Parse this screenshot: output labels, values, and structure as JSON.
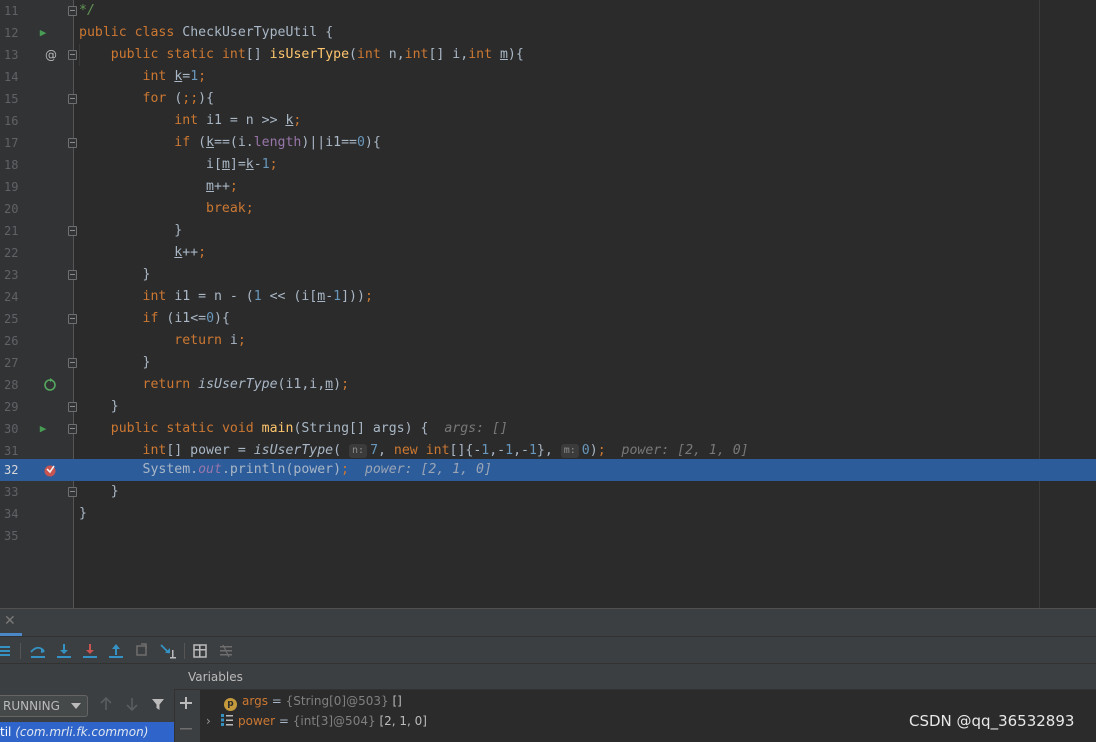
{
  "editor": {
    "lines": [
      {
        "num": "11"
      },
      {
        "num": "12"
      },
      {
        "num": "13"
      },
      {
        "num": "14"
      },
      {
        "num": "15"
      },
      {
        "num": "16"
      },
      {
        "num": "17"
      },
      {
        "num": "18"
      },
      {
        "num": "19"
      },
      {
        "num": "20"
      },
      {
        "num": "21"
      },
      {
        "num": "22"
      },
      {
        "num": "23"
      },
      {
        "num": "24"
      },
      {
        "num": "25"
      },
      {
        "num": "26"
      },
      {
        "num": "27"
      },
      {
        "num": "28"
      },
      {
        "num": "29"
      },
      {
        "num": "30"
      },
      {
        "num": "31"
      },
      {
        "num": "32"
      },
      {
        "num": "33"
      },
      {
        "num": "34"
      },
      {
        "num": "35"
      }
    ],
    "current_line": "32",
    "code": {
      "l11": {
        "cmt": "*/"
      },
      "l12": {
        "kw1": "public",
        "kw2": "class",
        "name": "CheckUserTypeUtil",
        "brace": "{"
      },
      "l13": {
        "kw1": "public",
        "kw2": "static",
        "kw3": "int",
        "arr": "[]",
        "fn": "isUserType",
        "p1": "(",
        "kw4": "int",
        "p2": "n,",
        "kw5": "int",
        "p3": "[] i,",
        "kw6": "int",
        "p4": "m",
        "p5": "){"
      },
      "l14": {
        "kw": "int",
        "v": "k",
        "op": "=",
        "num": "1",
        "semi": ";"
      },
      "l15": {
        "kw": "for",
        "rest1": "(",
        "semi": ";;",
        "rest2": "){"
      },
      "l16": {
        "kw": "int",
        "a": "i1 = n >> ",
        "v": "k",
        "semi": ";"
      },
      "l17": {
        "kw": "if",
        "a": "(",
        "v": "k",
        "b": "==(i.",
        "fld": "length",
        "c": ")||i1==",
        "num": "0",
        "d": "){"
      },
      "l18": {
        "a": "i[",
        "v": "m",
        "b": "]=",
        "v2": "k",
        "c": "-",
        "num": "1",
        "semi": ";"
      },
      "l19": {
        "v": "m",
        "a": "++",
        "semi": ";"
      },
      "l20": {
        "kw": "break",
        "semi": ";"
      },
      "l21": {
        "a": "}"
      },
      "l22": {
        "v": "k",
        "a": "++",
        "semi": ";"
      },
      "l23": {
        "a": "}"
      },
      "l24": {
        "kw": "int",
        "a": "i1 = n - (",
        "num": "1",
        "b": " << (i[",
        "v": "m",
        "c": "-",
        "num2": "1",
        "d": "]))",
        "semi": ";"
      },
      "l25": {
        "kw": "if",
        "a": "(i1<=",
        "num": "0",
        "b": "){"
      },
      "l26": {
        "kw": "return",
        "a": "i",
        "semi": ";"
      },
      "l27": {
        "a": "}"
      },
      "l28": {
        "kw": "return",
        "fn": "isUserType",
        "a": "(i1,i,",
        "v": "m",
        "b": ")",
        "semi": ";"
      },
      "l29": {
        "a": "}"
      },
      "l30": {
        "kw1": "public",
        "kw2": "static",
        "kw3": "void",
        "fn": "main",
        "a": "(String[] args) {",
        "inlay": "args: []"
      },
      "l31": {
        "kw": "int",
        "a": "[] power = ",
        "fn": "isUserType",
        "b": "(",
        "hint1": "n:",
        "num1": "7",
        "c": ", ",
        "kw2": "new",
        "kw3": "int",
        "d": "[]{-",
        "num2": "1",
        "e": ",-",
        "num3": "1",
        "f": ",-",
        "num4": "1",
        "g": "}, ",
        "hint2": "m:",
        "num5": "0",
        "h": ")",
        "semi": ";",
        "inlay": "power: [2, 1, 0]"
      },
      "l32": {
        "a": "System.",
        "fld": "out",
        "b": ".println(power)",
        "semi": ";",
        "inlay": "power: [2, 1, 0]"
      },
      "l33": {
        "a": "}"
      },
      "l34": {
        "a": "}"
      }
    }
  },
  "debugger": {
    "thread_state": "RUNNING",
    "frame_name": "til",
    "frame_package": "(com.mrli.fk.common)",
    "variables_title": "Variables",
    "variables": [
      {
        "tag": "p",
        "name": "args",
        "eq": " = ",
        "type": "{String[0]@503}",
        "value": "[]"
      },
      {
        "name": "power",
        "eq": " = ",
        "type": "{int[3]@504}",
        "value": "[2, 1, 0]"
      }
    ]
  },
  "watermark": "CSDN @qq_36532893",
  "colors": {
    "background": "#2b2b2b",
    "gutter": "#313335",
    "current_line": "#2d5c9b",
    "keyword": "#cc7832",
    "function": "#ffc66d",
    "number": "#6897bb",
    "field": "#9876aa",
    "comment": "#629755",
    "selected_frame": "#2f65ca"
  }
}
